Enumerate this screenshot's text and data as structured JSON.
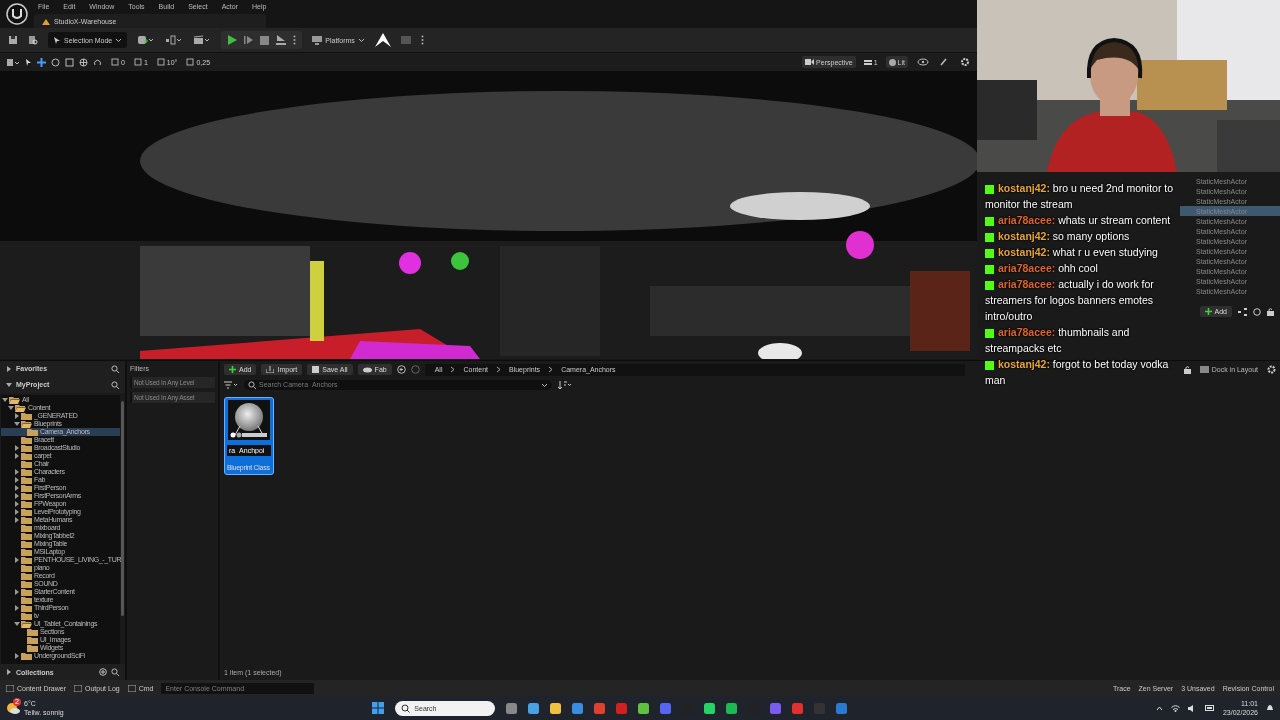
{
  "menu": [
    "File",
    "Edit",
    "Window",
    "Tools",
    "Build",
    "Select",
    "Actor",
    "Help"
  ],
  "level_tab": "StudioX-Warehouse",
  "toolbar": {
    "mode": "Selection Mode",
    "platforms": "Platforms"
  },
  "viewport_toolbar": {
    "snaps": [
      "0",
      "1",
      "10°",
      "0,25"
    ],
    "view": "Perspective",
    "camera_speed": "1",
    "view_mode": "Lit"
  },
  "outliner": {
    "rows": [
      {
        "type": "StaticMeshActor",
        "selected": false
      },
      {
        "type": "StaticMeshActor",
        "selected": false
      },
      {
        "type": "StaticMeshActor",
        "selected": false
      },
      {
        "type": "StaticMeshActor",
        "selected": true
      },
      {
        "type": "StaticMeshActor",
        "selected": false
      },
      {
        "type": "StaticMeshActor",
        "selected": false
      },
      {
        "type": "StaticMeshActor",
        "selected": false
      },
      {
        "type": "StaticMeshActor",
        "selected": false
      },
      {
        "type": "StaticMeshActor",
        "selected": false
      },
      {
        "type": "StaticMeshActor",
        "selected": false
      },
      {
        "type": "StaticMeshActor",
        "selected": false
      },
      {
        "type": "StaticMeshActor",
        "selected": false
      }
    ],
    "add": "Add",
    "dock": "Dock in Layout"
  },
  "chat": [
    {
      "user": "kostanj42:",
      "color": "#e8a53c",
      "text": "bro u need 2nd monitor to monitor the stream"
    },
    {
      "user": "aria78acee:",
      "color": "#e0642c",
      "text": "whats ur stream content"
    },
    {
      "user": "kostanj42:",
      "color": "#e8a53c",
      "text": "so many options"
    },
    {
      "user": "kostanj42:",
      "color": "#e8a53c",
      "text": "what r u even studying"
    },
    {
      "user": "aria78acee:",
      "color": "#e0642c",
      "text": "ohh cool"
    },
    {
      "user": "aria78acee:",
      "color": "#e0642c",
      "text": "actually i do work for streamers for logos banners emotes intro/outro"
    },
    {
      "user": "aria78acee:",
      "color": "#e0642c",
      "text": "thumbnails and streampacks etc"
    },
    {
      "user": "kostanj42:",
      "color": "#e8a53c",
      "text": "forgot to bet today vodka man"
    }
  ],
  "content_browser": {
    "favorites": "Favorites",
    "project": "MyProject",
    "collections": "Collections",
    "tree": [
      {
        "label": "All",
        "expandable": true,
        "expanded": true,
        "selected": false,
        "children": [
          {
            "label": "Content",
            "expandable": true,
            "expanded": true,
            "selected": false,
            "children": [
              {
                "label": "_GENERATED",
                "expandable": true,
                "expanded": false,
                "selected": false
              },
              {
                "label": "Blueprints",
                "expandable": true,
                "expanded": true,
                "selected": false,
                "children": [
                  {
                    "label": "Camera_Anchors",
                    "expandable": false,
                    "expanded": false,
                    "selected": true
                  }
                ]
              },
              {
                "label": "Bracett",
                "expandable": false,
                "expanded": false,
                "selected": false
              },
              {
                "label": "BroadcastStudio",
                "expandable": true,
                "expanded": false,
                "selected": false
              },
              {
                "label": "carpet",
                "expandable": true,
                "expanded": false,
                "selected": false
              },
              {
                "label": "Chair",
                "expandable": false,
                "expanded": false,
                "selected": false
              },
              {
                "label": "Characters",
                "expandable": true,
                "expanded": false,
                "selected": false
              },
              {
                "label": "Fab",
                "expandable": true,
                "expanded": false,
                "selected": false
              },
              {
                "label": "FirstPerson",
                "expandable": true,
                "expanded": false,
                "selected": false
              },
              {
                "label": "FirstPersonArms",
                "expandable": true,
                "expanded": false,
                "selected": false
              },
              {
                "label": "FPWeapon",
                "expandable": true,
                "expanded": false,
                "selected": false
              },
              {
                "label": "LevelPrototyping",
                "expandable": true,
                "expanded": false,
                "selected": false
              },
              {
                "label": "MetaHumans",
                "expandable": true,
                "expanded": false,
                "selected": false
              },
              {
                "label": "mixboard",
                "expandable": false,
                "expanded": false,
                "selected": false
              },
              {
                "label": "MixingTabbel2",
                "expandable": false,
                "expanded": false,
                "selected": false
              },
              {
                "label": "MixingTable",
                "expandable": false,
                "expanded": false,
                "selected": false
              },
              {
                "label": "MSILaptop",
                "expandable": false,
                "expanded": false,
                "selected": false
              },
              {
                "label": "PENTHOUSE_LIVING_-_TUR",
                "expandable": true,
                "expanded": false,
                "selected": false
              },
              {
                "label": "piano",
                "expandable": false,
                "expanded": false,
                "selected": false
              },
              {
                "label": "Record",
                "expandable": false,
                "expanded": false,
                "selected": false
              },
              {
                "label": "SOUND",
                "expandable": false,
                "expanded": false,
                "selected": false
              },
              {
                "label": "StarterContent",
                "expandable": true,
                "expanded": false,
                "selected": false
              },
              {
                "label": "texture",
                "expandable": false,
                "expanded": false,
                "selected": false
              },
              {
                "label": "ThirdPerson",
                "expandable": true,
                "expanded": false,
                "selected": false
              },
              {
                "label": "tv",
                "expandable": false,
                "expanded": false,
                "selected": false
              },
              {
                "label": "UI_Tablet_Containings",
                "expandable": true,
                "expanded": true,
                "selected": false,
                "children": [
                  {
                    "label": "Sections",
                    "expandable": false,
                    "expanded": false,
                    "selected": false
                  },
                  {
                    "label": "UI_Images",
                    "expandable": false,
                    "expanded": false,
                    "selected": false
                  },
                  {
                    "label": "Widgets",
                    "expandable": false,
                    "expanded": false,
                    "selected": false
                  }
                ]
              },
              {
                "label": "UndergroundSciFi",
                "expandable": true,
                "expanded": false,
                "selected": false
              }
            ]
          }
        ]
      }
    ],
    "filters_title": "Filters",
    "filters": [
      "Not Used In Any Level",
      "Not Used In Any Asset"
    ],
    "buttons": [
      "Add",
      "Import",
      "Save All",
      "Fab"
    ],
    "path": [
      "All",
      "Content",
      "Blueprints",
      "Camera_Anchors"
    ],
    "search_placeholder": "Search Camera_Anchors",
    "assets": [
      {
        "name": "ra_Anchpoi",
        "type": "Blueprint Class",
        "selected": true
      }
    ],
    "item_count": "1 item (1 selected)"
  },
  "status_bar": {
    "left": [
      "Content Drawer",
      "Output Log",
      "Cmd"
    ],
    "console_placeholder": "Enter Console Command",
    "right": [
      "Trace",
      "Zen Server",
      "3 Unsaved",
      "Revision Control"
    ]
  },
  "taskbar": {
    "weather_badge": "2",
    "temperature": "6°C",
    "weather": "Teilw. sonnig",
    "search_placeholder": "Search",
    "time": "11:01",
    "date": "23/02/2026"
  }
}
